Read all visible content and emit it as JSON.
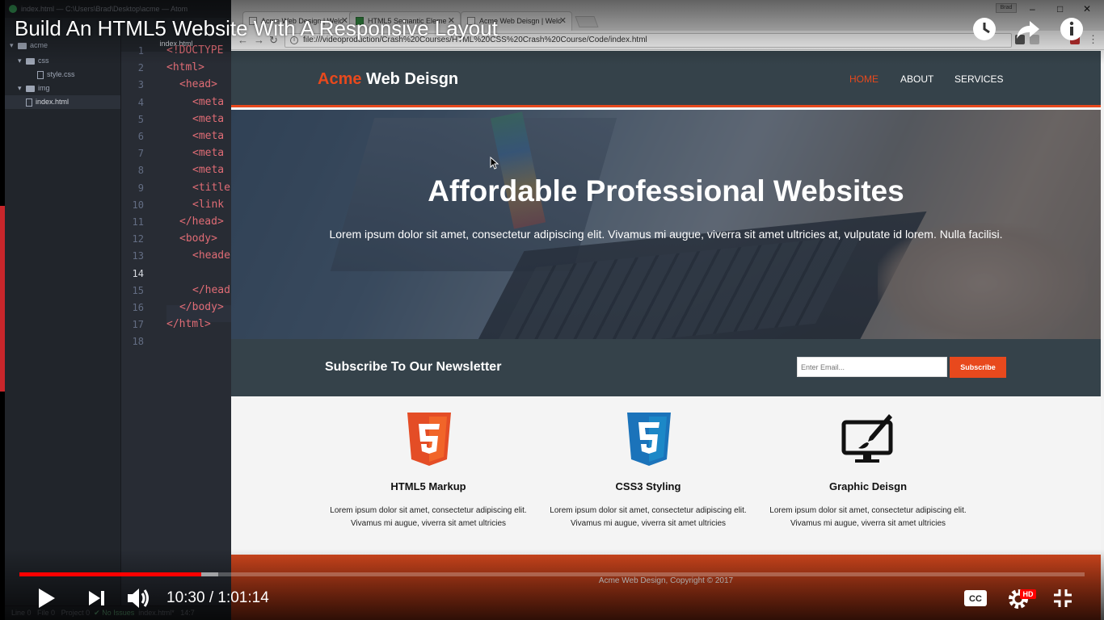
{
  "video": {
    "title": "Build An HTML5 Website With A Responsive Layout",
    "time_current": "10:30",
    "time_separator": "/",
    "time_total": "1:01:14",
    "progress": 0.171,
    "buffered": 0.187,
    "hd_badge": "HD",
    "icons": [
      "watch-later-icon",
      "share-icon",
      "info-icon",
      "play-icon",
      "next-icon",
      "volume-icon",
      "captions-icon",
      "settings-icon",
      "fullscreen-exit-icon"
    ]
  },
  "atom": {
    "window_title": "index.html — C:\\Users\\Brad\\Desktop\\acme — Atom",
    "tree": [
      {
        "label": "acme"
      },
      {
        "label": "css"
      },
      {
        "label": "style.css"
      },
      {
        "label": "img"
      },
      {
        "label": "index.html"
      }
    ],
    "editor_tab": "index.html",
    "lines": [
      {
        "n": "1",
        "text": "<!DOCTYPE"
      },
      {
        "n": "2",
        "text": "<html>"
      },
      {
        "n": "3",
        "text": "<head>"
      },
      {
        "n": "4",
        "text": "<meta"
      },
      {
        "n": "5",
        "text": "<meta"
      },
      {
        "n": "6",
        "text": "<meta"
      },
      {
        "n": "7",
        "text": "<meta"
      },
      {
        "n": "8",
        "text": "<meta"
      },
      {
        "n": "9",
        "text": "<title"
      },
      {
        "n": "10",
        "text": "<link"
      },
      {
        "n": "11",
        "text": "</head>"
      },
      {
        "n": "12",
        "text": "<body>"
      },
      {
        "n": "13",
        "text": "<heade"
      },
      {
        "n": "14",
        "text": ""
      },
      {
        "n": "15",
        "text": "</head"
      },
      {
        "n": "16",
        "text": "</body>"
      },
      {
        "n": "17",
        "text": "</html>"
      },
      {
        "n": "18",
        "text": ""
      }
    ],
    "status": {
      "line": "Line 0",
      "file": "File 0",
      "project": "Project 0",
      "issues": "No Issues",
      "filename": "index.html*",
      "pos": "14:7"
    }
  },
  "browser": {
    "tabs": [
      {
        "label": "Acme Web Design | Welc"
      },
      {
        "label": "HTML5 Semantic Eleme"
      },
      {
        "label": "Acme Web Deisgn | Welc"
      }
    ],
    "user_label": "Brad",
    "url": "file:///videoproduction/Crash%20Courses/HTML%20CSS%20Crash%20Course/Code/index.html"
  },
  "site": {
    "brand_highlight": "Acme",
    "brand_rest": "Web Deisgn",
    "nav": [
      {
        "label": "HOME"
      },
      {
        "label": "ABOUT"
      },
      {
        "label": "SERVICES"
      }
    ],
    "showcase": {
      "title": "Affordable Professional Websites",
      "text": "Lorem ipsum dolor sit amet, consectetur adipiscing elit. Vivamus mi augue, viverra sit amet ultricies at, vulputate id lorem. Nulla facilisi."
    },
    "newsletter": {
      "title": "Subscribe To Our Newsletter",
      "placeholder": "Enter Email...",
      "button": "Subscribe"
    },
    "boxes": [
      {
        "icon": "html5-icon",
        "title": "HTML5 Markup",
        "text": "Lorem ipsum dolor sit amet, consectetur adipiscing elit. Vivamus mi augue, viverra sit amet ultricies"
      },
      {
        "icon": "css3-icon",
        "title": "CSS3 Styling",
        "text": "Lorem ipsum dolor sit amet, consectetur adipiscing elit. Vivamus mi augue, viverra sit amet ultricies"
      },
      {
        "icon": "graphic-design-icon",
        "title": "Graphic Deisgn",
        "text": "Lorem ipsum dolor sit amet, consectetur adipiscing elit. Vivamus mi augue, viverra sit amet ultricies"
      }
    ],
    "footer": "Acme Web Design, Copyright © 2017"
  },
  "colors": {
    "accent": "#e8491d",
    "header_bg": "#35424a",
    "progress": "#ff0000"
  }
}
